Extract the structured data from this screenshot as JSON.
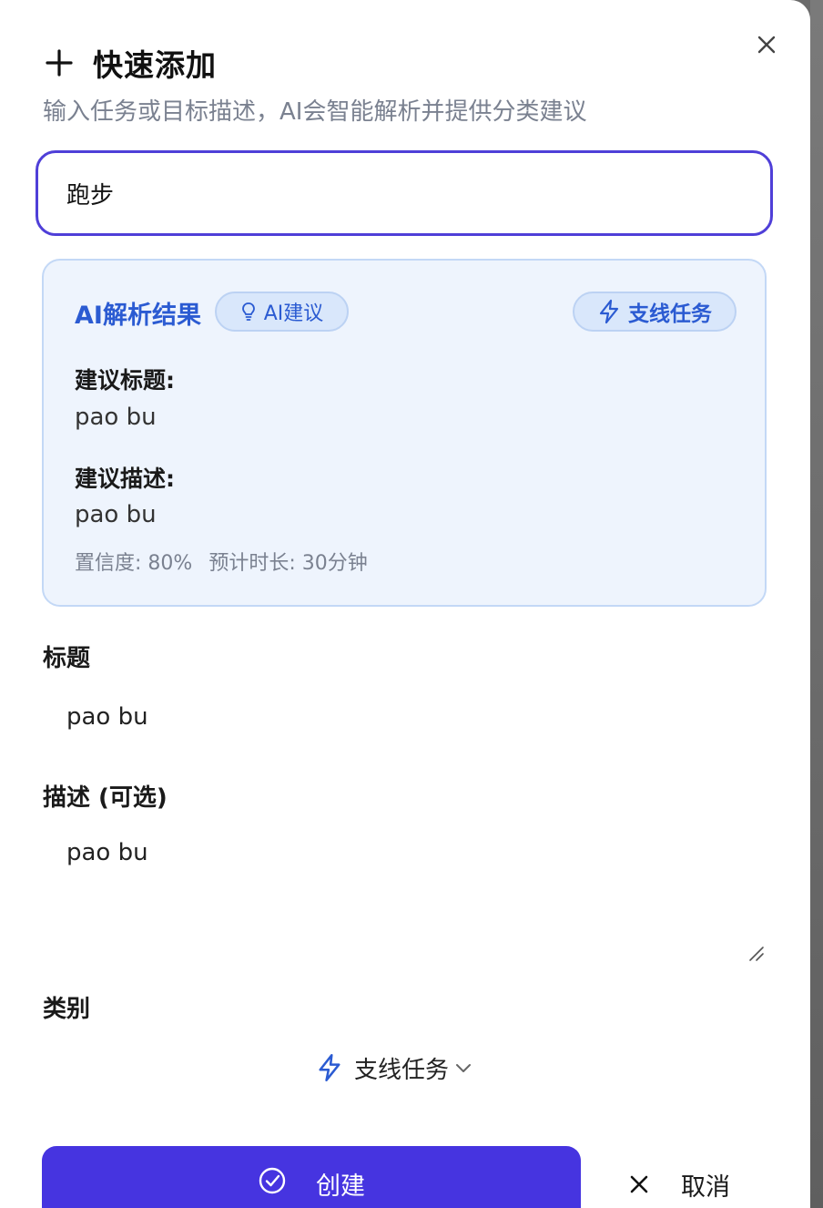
{
  "dialog": {
    "title": "快速添加",
    "subtitle": "输入任务或目标描述，AI会智能解析并提供分类建议",
    "input_value": "跑步"
  },
  "ai_result": {
    "heading": "AI解析结果",
    "ai_badge": "AI建议",
    "category_badge": "支线任务",
    "suggested_title_label": "建议标题:",
    "suggested_title_value": "pao bu",
    "suggested_desc_label": "建议描述:",
    "suggested_desc_value": "pao bu",
    "confidence": "置信度: 80%",
    "duration": "预计时长: 30分钟"
  },
  "form": {
    "title_label": "标题",
    "title_value": "pao bu",
    "desc_label": "描述 (可选)",
    "desc_value": "pao bu",
    "category_label": "类别",
    "category_value": "支线任务"
  },
  "actions": {
    "create_label": "创建",
    "cancel_label": "取消"
  },
  "colors": {
    "accent": "#4634e0",
    "ai_blue": "#2b5bd2",
    "card_bg": "#eef4fd"
  },
  "icons": [
    "plus-icon",
    "close-icon",
    "lightbulb-icon",
    "lightning-icon",
    "chevron-down-icon",
    "check-circle-icon"
  ]
}
